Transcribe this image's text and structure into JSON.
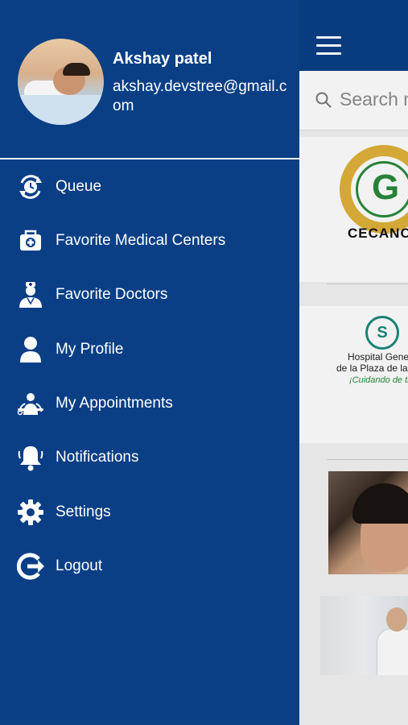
{
  "background": {
    "search_placeholder": "Search m",
    "cards": [
      {
        "logo_text": "CECANO"
      },
      {
        "logo_line1": "Hospital Gener",
        "logo_line2": "de la Plaza de la S",
        "logo_tagline": "¡Cuidando de ti"
      }
    ]
  },
  "drawer": {
    "user": {
      "name": "Akshay patel",
      "email": "akshay.devstree@gmail.com"
    },
    "menu": [
      {
        "label": "Queue",
        "icon": "queue-clock-icon"
      },
      {
        "label": "Favorite Medical Centers",
        "icon": "medical-center-icon"
      },
      {
        "label": "Favorite Doctors",
        "icon": "doctor-icon"
      },
      {
        "label": "My Profile",
        "icon": "person-icon"
      },
      {
        "label": "My Appointments",
        "icon": "appointment-icon"
      },
      {
        "label": "Notifications",
        "icon": "bell-icon"
      },
      {
        "label": "Settings",
        "icon": "gear-icon"
      },
      {
        "label": "Logout",
        "icon": "logout-icon"
      }
    ]
  },
  "colors": {
    "primary": "#0a3f86",
    "text_on_primary": "#ffffff"
  }
}
